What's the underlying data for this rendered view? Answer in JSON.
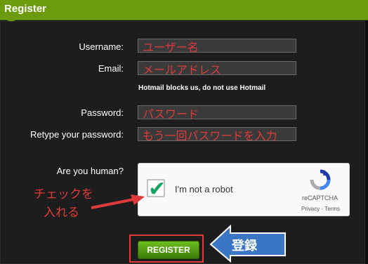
{
  "header": {
    "title": "Register"
  },
  "form": {
    "username_label": "Username:",
    "email_label": "Email:",
    "hint": "Hotmail blocks us, do not use Hotmail",
    "password_label": "Password:",
    "retype_label": "Retype your password:",
    "human_label": "Are you human?"
  },
  "annotations": {
    "username": "ユーザー名",
    "email": "メールアドレス",
    "password": "パスワード",
    "retype": "もう一回パスワードを入力",
    "check_line1": "チェックを",
    "check_line2": "入れる",
    "register": "登録"
  },
  "captcha": {
    "checkbox_label": "I'm not a robot",
    "brand": "reCAPTCHA",
    "links": "Privacy - Terms",
    "checked": true
  },
  "register_button": "REGISTER",
  "colors": {
    "header": "#6c9c0e",
    "annotation": "#e03a3a",
    "arrow": "#3a76c4",
    "button": "#5aa516"
  }
}
